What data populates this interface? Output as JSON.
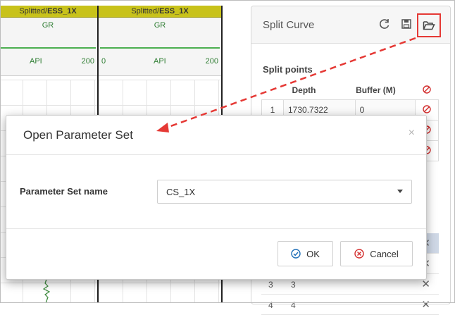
{
  "tracks": [
    {
      "title_prefix": "Splitted/",
      "title_bold": "ESS_1X",
      "curve": "GR",
      "scale_min": "",
      "unit": "API",
      "scale_max": "200"
    },
    {
      "title_prefix": "Splitted/",
      "title_bold": "ESS_1X",
      "curve": "GR",
      "scale_min": "0",
      "unit": "API",
      "scale_max": "200"
    }
  ],
  "panel": {
    "title": "Split Curve",
    "toolbar_icons": [
      "refresh-icon",
      "save-icon",
      "open-folder-icon"
    ],
    "split_points_label": "Split points",
    "columns": [
      "",
      "Depth",
      "Buffer (M)",
      ""
    ],
    "split_points": [
      {
        "index": "1",
        "depth": "1730.7322",
        "buffer": "0"
      },
      {
        "index": "",
        "depth": "",
        "buffer": ""
      },
      {
        "index": "",
        "depth": "",
        "buffer": ""
      }
    ],
    "lower_list": [
      {
        "index": "",
        "value": ""
      },
      {
        "index": "",
        "value": ""
      },
      {
        "index": "3",
        "value": "3"
      },
      {
        "index": "4",
        "value": "4"
      }
    ]
  },
  "modal": {
    "title": "Open Parameter Set",
    "close_glyph": "×",
    "field_label": "Parameter Set name",
    "selected_value": "CS_1X",
    "ok_label": "OK",
    "cancel_label": "Cancel"
  },
  "colors": {
    "track_title_bg": "#c8c21a",
    "curve": "#4caf50",
    "highlight": "#e53935",
    "delete": "#d32f2f",
    "ok_icon": "#1e6fb8",
    "cancel_icon": "#d32f2f"
  }
}
